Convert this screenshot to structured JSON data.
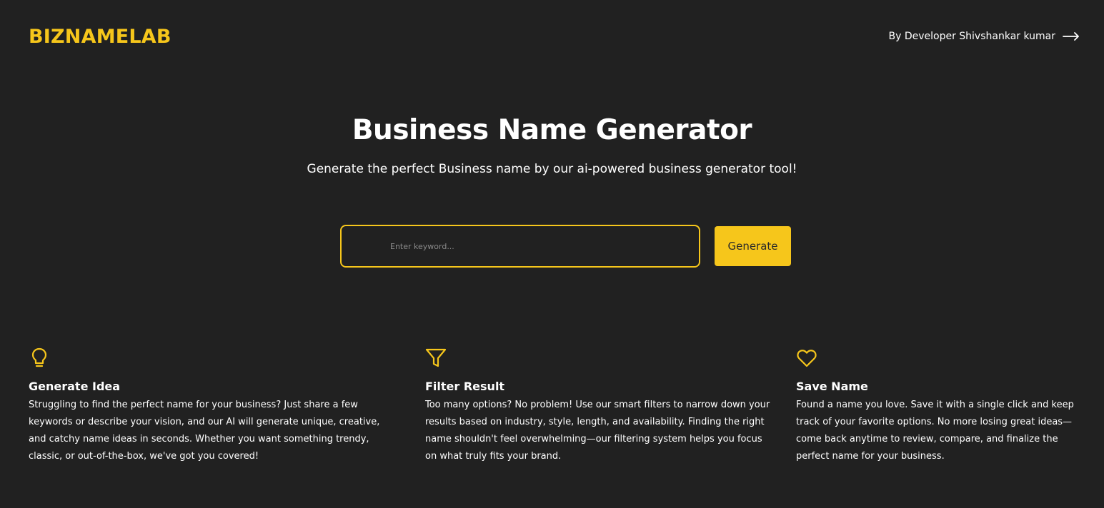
{
  "header": {
    "logo": "BIZNAMELAB",
    "developer_link": "By Developer Shivshankar kumar",
    "developer_link_icon": "arrow-right-icon"
  },
  "hero": {
    "title": "Business Name Generator",
    "subtitle": "Generate the perfect Business name by our ai-powered business generator tool!"
  },
  "search": {
    "value": "",
    "placeholder": "Enter keyword...",
    "button_label": "Generate"
  },
  "features": [
    {
      "icon": "lightbulb-icon",
      "title": "Generate Idea",
      "description": "Struggling to find the perfect name for your business? Just share a few keywords or describe your vision, and our AI will generate unique, creative, and catchy name ideas in seconds. Whether you want something trendy, classic, or out-of-the-box, we've got you covered!"
    },
    {
      "icon": "filter-icon",
      "title": "Filter Result",
      "description": "Too many options? No problem! Use our smart filters to narrow down your results based on industry, style, length, and availability. Finding the right name shouldn't feel overwhelming—our filtering system helps you focus on what truly fits your brand."
    },
    {
      "icon": "heart-icon",
      "title": "Save Name",
      "description": "Found a name you love. Save it with a single click and keep track of your favorite options. No more losing great ideas—come back anytime to review, compare, and finalize the perfect name for your business."
    }
  ],
  "colors": {
    "background": "#212121",
    "accent": "#f6c61b",
    "text": "#ffffff"
  }
}
